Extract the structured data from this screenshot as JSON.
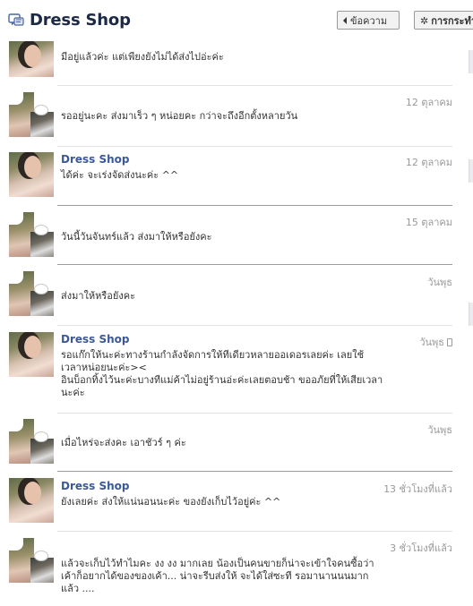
{
  "header": {
    "title": "Dress Shop",
    "message_button": "ข้อความ",
    "actions_button": "การกระทำ"
  },
  "messages": [
    {
      "sender": "",
      "time": "",
      "lines": [
        "มีอยู่แล้วค่ะ แต่เพียงยังไม่ได้ส่งไปอ่ะค่ะ"
      ]
    },
    {
      "sender": "",
      "time": "12 ตุลาคม",
      "lines": [
        "รออยู่นะคะ ส่งมาเร็ว ๆ หน่อยคะ กว่าจะถึงอีกตั้งหลายวัน"
      ]
    },
    {
      "sender": "Dress Shop",
      "time": "12 ตุลาคม",
      "lines": [
        "ได้ค่ะ จะเร่งจัดส่งนะค่ะ ^^"
      ]
    },
    {
      "sender": "",
      "time": "15 ตุลาคม",
      "lines": [
        "วันนี้วันจันทร์แล้ว ส่งมาให้หรือยังคะ"
      ]
    },
    {
      "sender": "",
      "time": "วันพุธ",
      "lines": [
        "ส่งมาให้หรือยังคะ"
      ]
    },
    {
      "sender": "Dress Shop",
      "time": "วันพุธ",
      "lines": [
        "รอแก๊กให้นะค่ะทางร้านกำลังจัดการให้ทีเดียวหลายออเดอรเลยค่ะ เลยใช้เวลาหน่อยนะค่ะ><",
        "อินบ็อกทิ้งไว้นะค่ะบางทีแม่ค้าไม่อยู่ร้านอ่ะค่ะเลยตอบช้า ขออภัยที่ให้เสียเวลานะค่ะ"
      ]
    },
    {
      "sender": "",
      "time": "วันพุธ",
      "lines": [
        "เมื่อไหร่จะส่งคะ เอาชัวร์ ๆ ค่ะ"
      ]
    },
    {
      "sender": "Dress Shop",
      "time": "13 ชั่วโมงที่แล้ว",
      "lines": [
        "ยังเลยค่ะ ส่งให้แน่นอนนะค่ะ ของยังเก็บไว้อยู่ค่ะ ^^"
      ]
    },
    {
      "sender": "",
      "time": "3 ชั่วโมงที่แล้ว",
      "lines": [
        "แล้วจะเก็บไว้ทำไมคะ งง งง มากเลย น้องเป็นคนขายก็น่าจะเข้าใจคนซื้อว่าเค้าก็อยากได้ของของเค้า... น่าจะรีบส่งให้ จะได้ใส่ซะที รอมานานนนมากแล้ว ...."
      ]
    }
  ]
}
